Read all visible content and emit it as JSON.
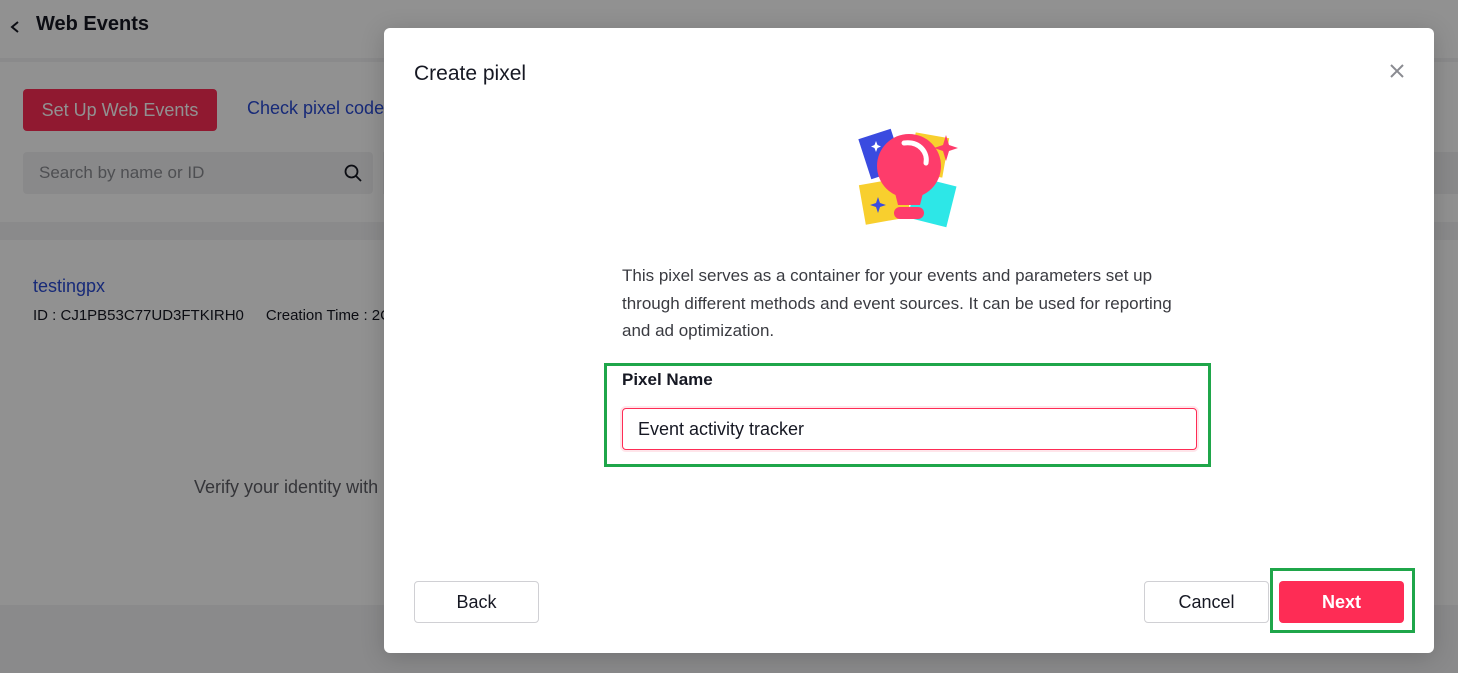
{
  "header": {
    "title": "Web Events"
  },
  "toolbar": {
    "setup_label": "Set Up Web Events",
    "check_label": "Check pixel code"
  },
  "search": {
    "placeholder": "Search by name or ID",
    "value": ""
  },
  "pixel_item": {
    "name": "testingpx",
    "id_text": "ID : CJ1PB53C77UD3FTKIRH0",
    "creation_text": "Creation Time : 2C"
  },
  "verify_text": "Verify your identity with",
  "modal": {
    "title": "Create pixel",
    "description": "This pixel serves as a container for your events and parameters set up through different methods and event sources. It can be used for reporting and ad optimization.",
    "field_label": "Pixel Name",
    "field_value": "Event activity tracker",
    "back_label": "Back",
    "cancel_label": "Cancel",
    "next_label": "Next"
  },
  "colors": {
    "accent": "#fe2c55",
    "link": "#2a4ad4",
    "highlight": "#1fa64a"
  },
  "icons": {
    "back": "chevron-left-icon",
    "search": "search-icon",
    "close": "close-icon",
    "illustration": "lightbulb-illustration-icon"
  }
}
